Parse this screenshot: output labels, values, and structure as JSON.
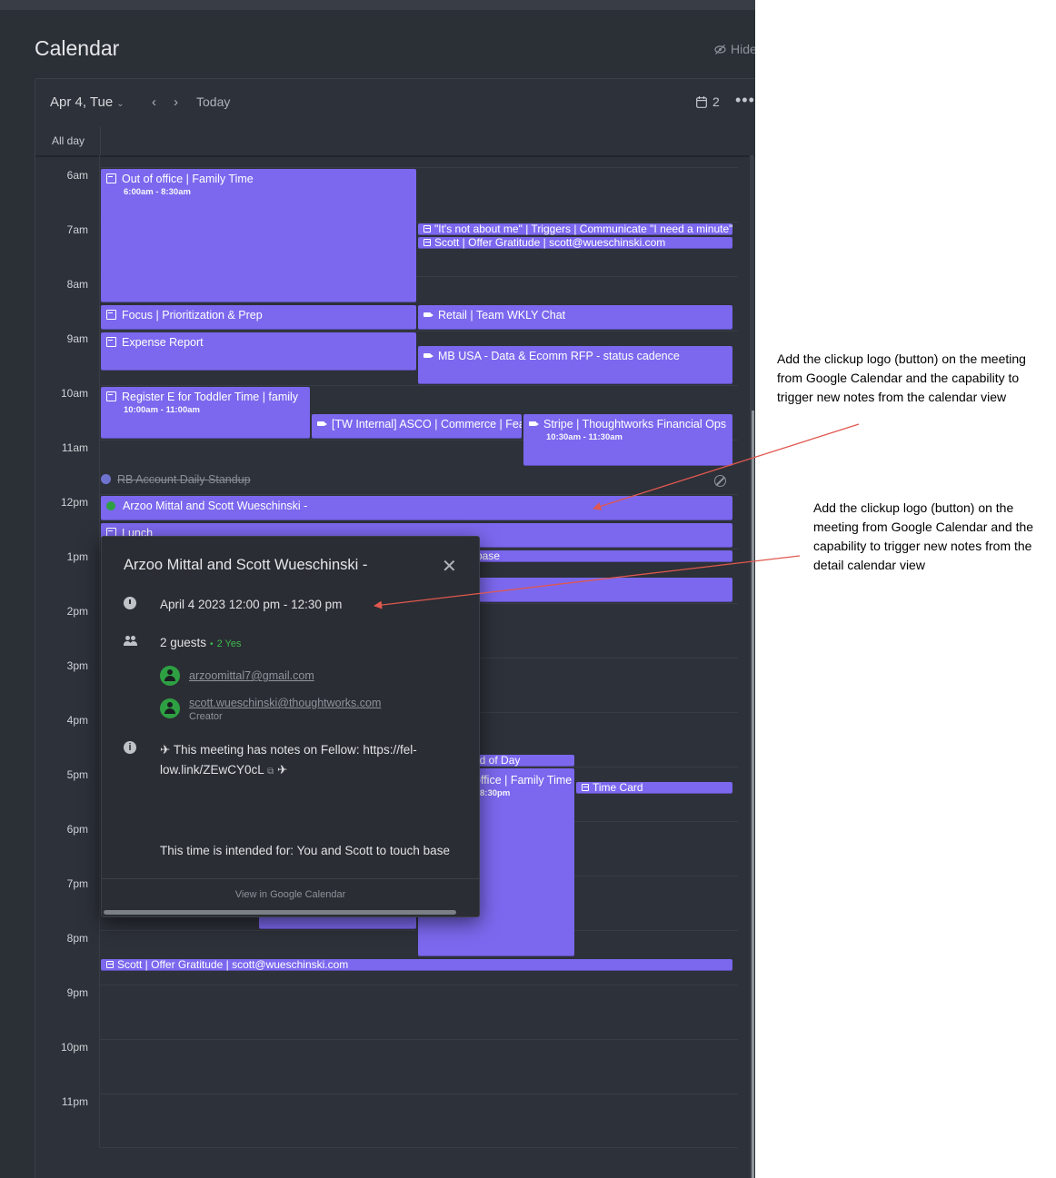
{
  "header": {
    "title": "Calendar",
    "hide_label": "Hide"
  },
  "toolbar": {
    "date": "Apr 4, Tue",
    "today": "Today",
    "day_count": "2"
  },
  "allday": {
    "label": "All day"
  },
  "hours": [
    "6am",
    "7am",
    "8am",
    "9am",
    "10am",
    "11am",
    "12pm",
    "1pm",
    "2pm",
    "3pm",
    "4pm",
    "5pm",
    "6pm",
    "7pm",
    "8pm",
    "9pm",
    "10pm",
    "11pm"
  ],
  "events": {
    "out_of_office": {
      "title": "Out of office | Family Time",
      "time": "6:00am - 8:30am"
    },
    "not_about_me": {
      "title": "\"It's not about me\" | Triggers | Communicate \"I need a minute\""
    },
    "gratitude_am": {
      "title": "Scott | Offer Gratitude | scott@wueschinski.com"
    },
    "focus": {
      "title": "Focus | Prioritization & Prep"
    },
    "retail": {
      "title": "Retail | Team WKLY Chat"
    },
    "expense": {
      "title": "Expense Report"
    },
    "mb_usa": {
      "title": "MB USA - Data & Ecomm RFP - status cadence"
    },
    "toddler": {
      "title": "Register E for Toddler Time | family",
      "time": "10:00am - 11:00am"
    },
    "tw_internal": {
      "title": "[TW Internal] ASCO | Commerce | Feature sync"
    },
    "stripe": {
      "title": "Stripe | Thoughtworks Financial Ops",
      "time": "10:30am - 11:30am"
    },
    "rb_standup": {
      "title": "RB Account Daily Standup"
    },
    "arzoo": {
      "title": "Arzoo Mittal and Scott Wueschinski -"
    },
    "lunch": {
      "title": "Lunch"
    },
    "touch_base": {
      "title": "base"
    },
    "end_of_day": {
      "title": "nd of Day"
    },
    "family_pm": {
      "title": "office | Family Time",
      "time": "8:30pm"
    },
    "time_card": {
      "title": "Time Card"
    },
    "gratitude_pm": {
      "title": "Scott | Offer Gratitude | scott@wueschinski.com"
    }
  },
  "popup": {
    "title": "Arzoo Mittal and Scott Wueschinski -",
    "close": "✕",
    "datetime": "April 4 2023 12:00 pm - 12:30 pm",
    "guests_count": "2 guests",
    "guests_sep": "•",
    "guests_yes": "2 Yes",
    "guests": [
      {
        "email": "arzoomittal7@gmail.com",
        "role": ""
      },
      {
        "email": "scott.wueschinski@thoughtworks.com",
        "role": "Creator"
      }
    ],
    "notes_line1": "✈ This meeting has notes on Fellow: https://fel-",
    "notes_link": "low.link/ZEwCY0cL",
    "notes_ext": "⧉",
    "notes_end": "✈",
    "intended": "This time is intended for: You and Scott to touch base",
    "view_link": "View in Google Calendar"
  },
  "annotations": {
    "first": "Add the clickup logo (button) on the meeting from Google Calendar and the capability to trigger new notes from the calendar view",
    "second": "Add the clickup logo (button) on the meeting from Google Calendar and the capability to trigger new notes from the detail calendar view"
  },
  "colors": {
    "event": "#7b68ee",
    "background": "#2b2f36",
    "accent_green": "#3fb950",
    "arrow": "#e0584f"
  }
}
